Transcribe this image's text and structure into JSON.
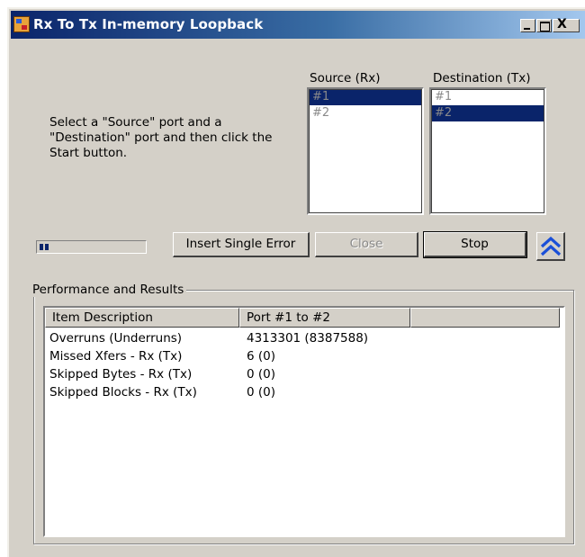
{
  "window": {
    "title": "Rx To Tx In-memory Loopback",
    "close_glyph": "X"
  },
  "instructions": "Select a \"Source\" port and a \"Destination\" port and then click the Start button.",
  "source": {
    "label": "Source (Rx)",
    "items": [
      "#1",
      "#2"
    ],
    "selected": "#1"
  },
  "destination": {
    "label": "Destination (Tx)",
    "items": [
      "#1",
      "#2"
    ],
    "selected": "#2"
  },
  "buttons": {
    "insert_error": "Insert Single Error",
    "close": "Close",
    "stop": "Stop"
  },
  "results": {
    "group_title": "Performance and Results",
    "columns": [
      "Item Description",
      "Port #1 to #2",
      ""
    ],
    "rows": [
      {
        "item": "Overruns (Underruns)",
        "value": "4313301 (8387588)"
      },
      {
        "item": "Missed Xfers - Rx (Tx)",
        "value": "6 (0)"
      },
      {
        "item": "Skipped Bytes - Rx (Tx)",
        "value": "0 (0)"
      },
      {
        "item": "Skipped Blocks - Rx (Tx)",
        "value": "0 (0)"
      }
    ]
  },
  "colors": {
    "titlebar_start": "#0a246a",
    "selection": "#0a246a",
    "chevron": "#1a4fd8"
  },
  "icons": {
    "app": "app-icon",
    "collapse": "double-chevron-up-icon"
  }
}
